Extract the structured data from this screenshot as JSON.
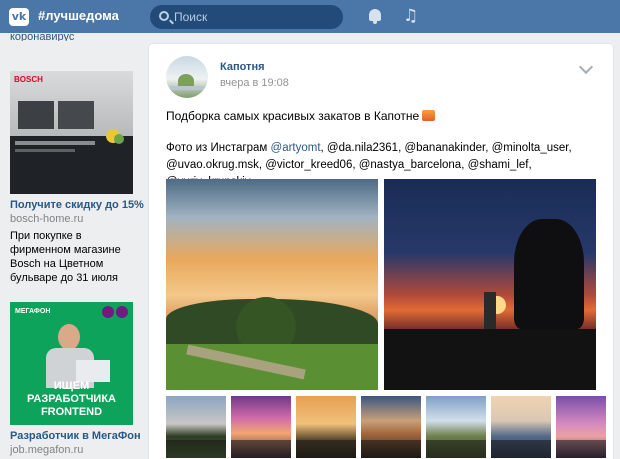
{
  "header": {
    "logo_text": "vk",
    "hashtag": "#лучшедома",
    "search_placeholder": "Поиск",
    "icons": [
      "vk-logo-icon",
      "search-icon",
      "bell-icon",
      "music-icon"
    ]
  },
  "left": {
    "top_link": "коронавирус",
    "ad1": {
      "brand": "BOSCH",
      "title": "Получите скидку до 15%",
      "domain": "bosch-home.ru",
      "description": "При покупке в фирменном магазине Bosch на Цветном бульваре до 31 июля"
    },
    "ad2": {
      "brand": "МЕГАФОН",
      "banner_text": "ИЩЕМ РАЗРАБОТЧИКА FRONTEND",
      "title": "Разработчик в МегаФон",
      "domain": "job.megafon.ru"
    }
  },
  "post": {
    "author": "Капотня",
    "date": "вчера в 19:08",
    "text_line1": "Подборка самых красивых закатов в Капотне",
    "text_intro": "Фото из Инстаграм",
    "mentions": "@artyomt",
    "text_rest": ", @da.nila2361, @bananakinder, @minolta_user, @uvao.okrug.msk, @victor_kreed06, @nastya_barcelona, @shami_lef, @yuriy_krupskiy",
    "photos_large": 2,
    "photos_thumbs": 7
  },
  "colors": {
    "header_bg": "#4a76a8",
    "link": "#2a5885",
    "page_bg": "#edeef0",
    "megafon_green": "#0da35b"
  }
}
